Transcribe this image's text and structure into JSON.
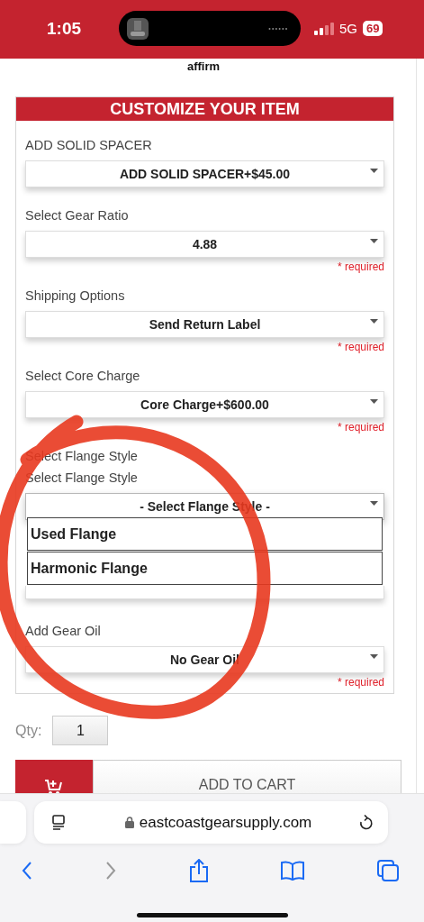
{
  "status_bar": {
    "time": "1:05",
    "network": "5G",
    "battery": "69"
  },
  "logo": "affirm",
  "panel_title": "CUSTOMIZE YOUR ITEM",
  "fields": [
    {
      "kind": "select",
      "label": "ADD SOLID SPACER",
      "value": "ADD SOLID SPACER+$45.00"
    },
    {
      "kind": "select",
      "label": "Select Gear Ratio",
      "value": "4.88",
      "required": "* required"
    },
    {
      "kind": "select",
      "label": "Shipping Options",
      "value": "Send Return Label",
      "required": "* required"
    },
    {
      "kind": "select",
      "label": "Select Core Charge",
      "value": "Core Charge+$600.00",
      "required": "* required"
    },
    {
      "kind": "select",
      "label": "Select Flange Style",
      "sublabel": "Select Flange Style",
      "value": "- Select Flange Style -",
      "expanded": true,
      "options": [
        {
          "label": "Used Flange",
          "selected": false
        },
        {
          "label": "Harmonic Flange",
          "selected": false
        }
      ]
    },
    {
      "kind": "covered"
    },
    {
      "kind": "select",
      "label": "Add Gear Oil",
      "value": "No Gear Oil",
      "required": "* required"
    }
  ],
  "qty": {
    "label": "Qty:",
    "value": "1"
  },
  "add_to_cart": "ADD TO CART",
  "browser": {
    "url": "eastcoastgearsupply.com"
  }
}
